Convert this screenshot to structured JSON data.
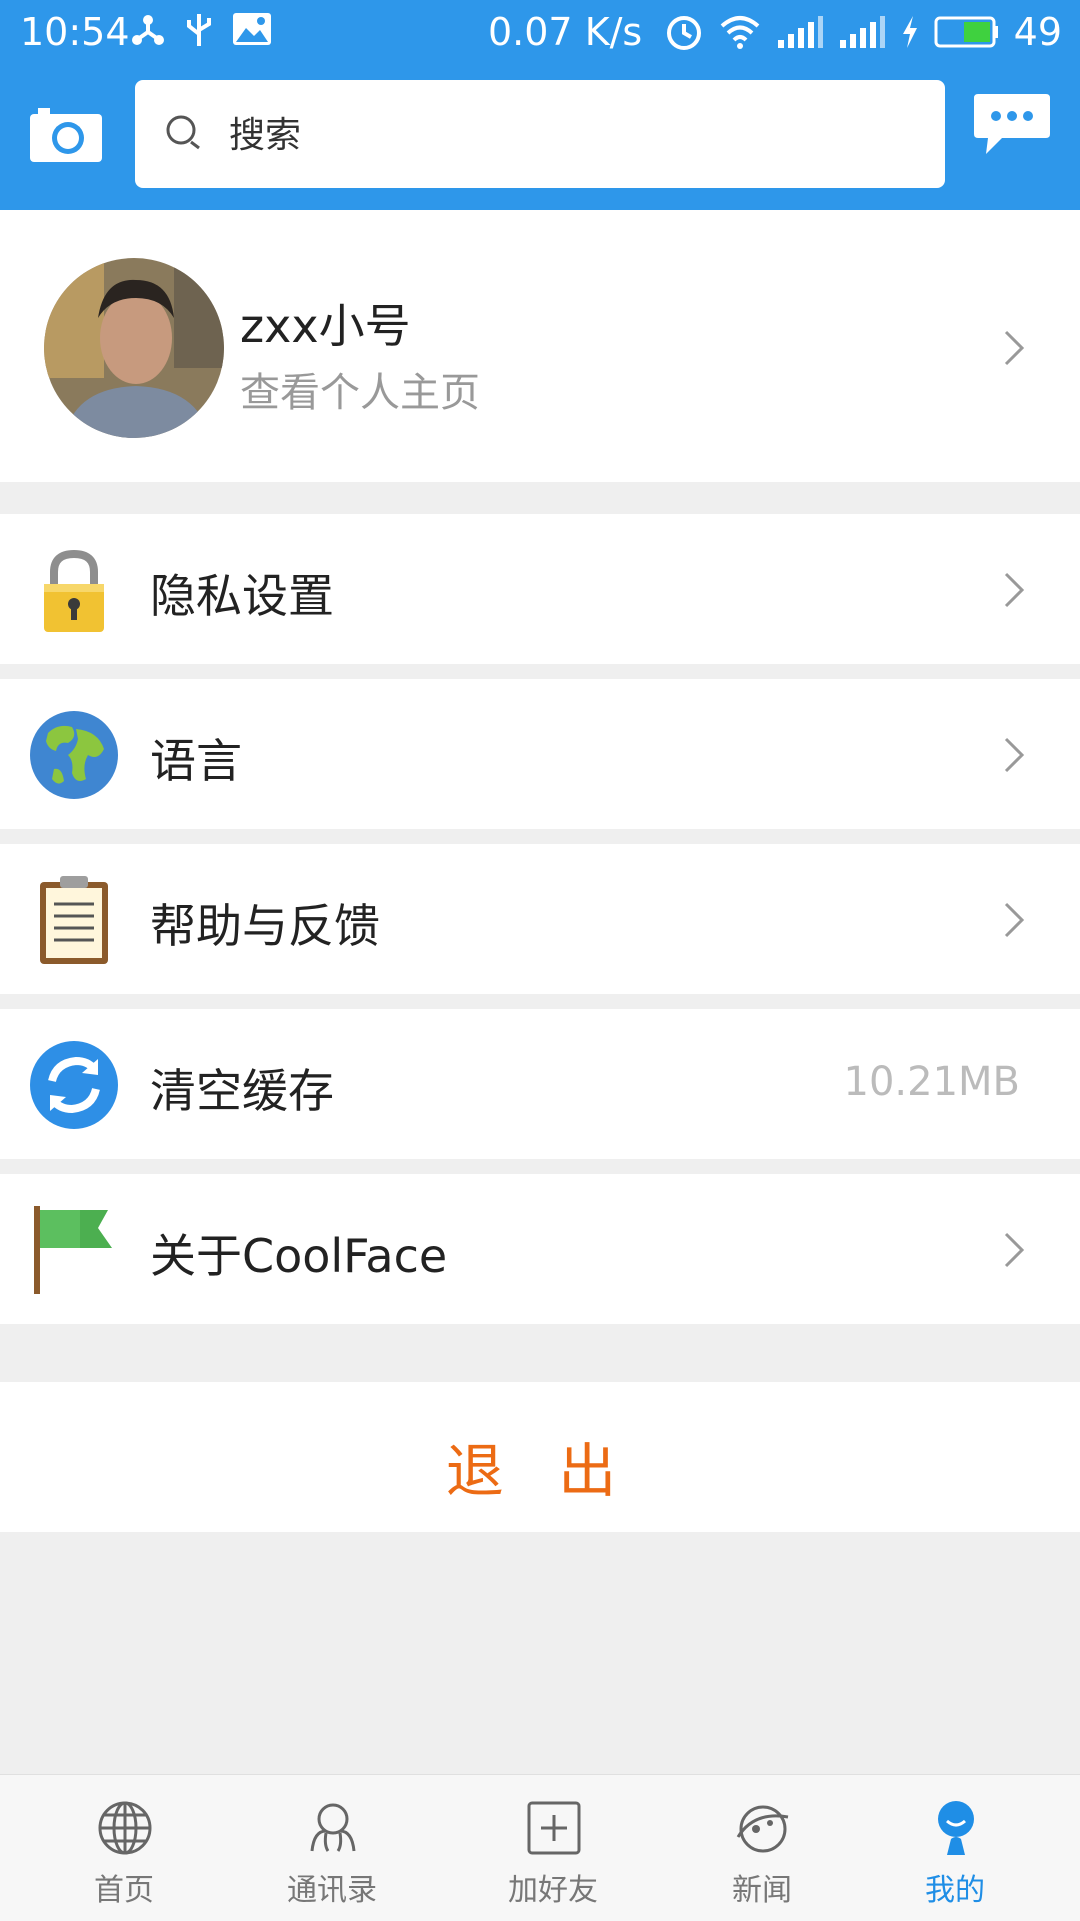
{
  "status_bar": {
    "time": "10:54",
    "speed": "0.07 K/s",
    "battery": "49"
  },
  "search": {
    "placeholder": "搜索"
  },
  "profile": {
    "name": "zxx小号",
    "subtitle": "查看个人主页"
  },
  "menu": [
    {
      "label": "隐私设置",
      "icon": "lock-icon"
    },
    {
      "label": "语言",
      "icon": "globe-icon"
    },
    {
      "label": "帮助与反馈",
      "icon": "clipboard-icon"
    },
    {
      "label": "清空缓存",
      "icon": "refresh-icon",
      "value": "10.21MB"
    },
    {
      "label": "关于CoolFace",
      "icon": "flag-icon"
    }
  ],
  "logout": {
    "label": "退 出"
  },
  "tabs": [
    {
      "label": "首页",
      "icon": "globe-tab-icon"
    },
    {
      "label": "通讯录",
      "icon": "contacts-icon"
    },
    {
      "label": "加好友",
      "icon": "add-friend-icon"
    },
    {
      "label": "新闻",
      "icon": "news-icon"
    },
    {
      "label": "我的",
      "icon": "me-icon",
      "active": true
    }
  ],
  "colors": {
    "primary": "#2e97ea",
    "logout": "#ec6b14",
    "active_tab": "#1f8ee6"
  }
}
